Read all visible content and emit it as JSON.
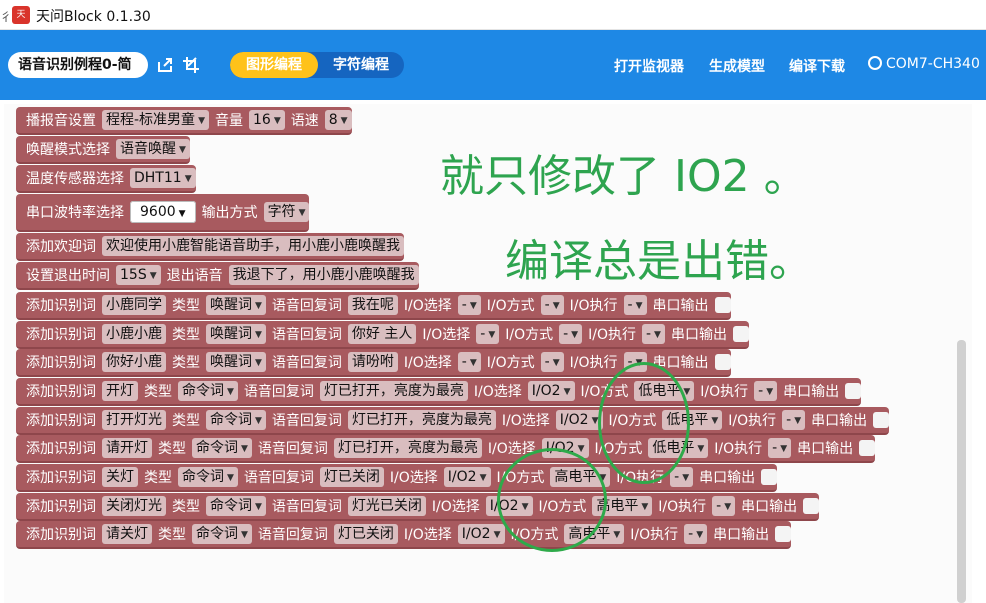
{
  "window": {
    "title": "天问Block 0.1.30",
    "side_glyph": "彳"
  },
  "toolbar": {
    "project_name": "语音识别例程0-简",
    "mode_graphic": "图形编程",
    "mode_text": "字符编程",
    "monitor": "打开监视器",
    "gen_model": "生成模型",
    "compile_download": "编译下载",
    "port": "COM7-CH340"
  },
  "annotations": {
    "line1": "就只修改了 IO2 。",
    "line2": "编译总是出错。",
    "color": "#2ea44f"
  },
  "blocks": {
    "b1": {
      "label": "播报音设置",
      "voice": "程程-标准男童",
      "vol_label": "音量",
      "vol": "16",
      "speed_label": "语速",
      "speed": "8"
    },
    "b2": {
      "label": "唤醒模式选择",
      "mode": "语音唤醒"
    },
    "b3": {
      "label": "温度传感器选择",
      "sensor": "DHT11"
    },
    "b4": {
      "label": "串口波特率选择",
      "baud": "9600",
      "out_label": "输出方式",
      "out": "字符"
    },
    "b5": {
      "label": "添加欢迎词",
      "text": "欢迎使用小鹿智能语音助手，用小鹿小鹿唤醒我"
    },
    "b6": {
      "label": "设置退出时间",
      "time": "15S",
      "exit_label": "退出语音",
      "text": "我退下了，用小鹿小鹿唤醒我"
    },
    "common": {
      "add": "添加识别词",
      "type": "类型",
      "reply": "语音回复词",
      "io_sel": "I/O选择",
      "io_mode": "I/O方式",
      "io_exec": "I/O执行",
      "serial": "串口输出",
      "dash": "-"
    },
    "rows": [
      {
        "word": "小鹿同学",
        "type": "唤醒词",
        "reply": "我在呢",
        "io": "-",
        "mode": "-",
        "exec": "-"
      },
      {
        "word": "小鹿小鹿",
        "type": "唤醒词",
        "reply": "你好 主人",
        "io": "-",
        "mode": "-",
        "exec": "-"
      },
      {
        "word": "你好小鹿",
        "type": "唤醒词",
        "reply": "请吩咐",
        "io": "-",
        "mode": "-",
        "exec": "-"
      },
      {
        "word": "开灯",
        "type": "命令词",
        "reply": "灯已打开，亮度为最亮",
        "io": "I/O2",
        "mode": "低电平",
        "exec": "-"
      },
      {
        "word": "打开灯光",
        "type": "命令词",
        "reply": "灯已打开，亮度为最亮",
        "io": "I/O2",
        "mode": "低电平",
        "exec": "-"
      },
      {
        "word": "请开灯",
        "type": "命令词",
        "reply": "灯已打开，亮度为最亮",
        "io": "I/O2",
        "mode": "低电平",
        "exec": "-"
      },
      {
        "word": "关灯",
        "type": "命令词",
        "reply": "灯已关闭",
        "io": "I/O2",
        "mode": "高电平",
        "exec": "-"
      },
      {
        "word": "关闭灯光",
        "type": "命令词",
        "reply": "灯光已关闭",
        "io": "I/O2",
        "mode": "高电平",
        "exec": "-"
      },
      {
        "word": "请关灯",
        "type": "命令词",
        "reply": "灯已关闭",
        "io": "I/O2",
        "mode": "高电平",
        "exec": "-"
      }
    ]
  }
}
